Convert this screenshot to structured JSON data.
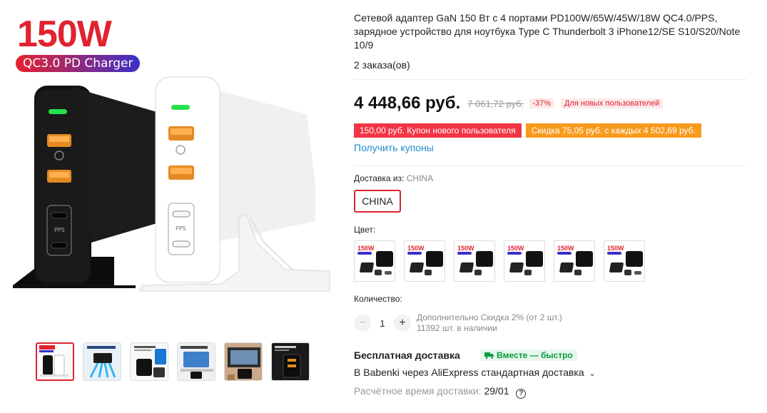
{
  "gallery": {
    "promo_title": "150W",
    "promo_pill": "QC3.0 PD Charger",
    "thumbnails": [
      "thumb-1",
      "thumb-2",
      "thumb-3",
      "thumb-4",
      "thumb-5",
      "thumb-6"
    ]
  },
  "product": {
    "title": "Сетевой адаптер GaN 150 Вт с 4 портами PD100W/65W/45W/18W QC4.0/PPS, зарядное устройство для ноутбука Type C Thunderbolt 3 iPhone12/SE S10/S20/Note 10/9",
    "orders": "2 заказа(ов)"
  },
  "price": {
    "current": "4 448,66 руб.",
    "old": "7 061,72 руб.",
    "discount": "-37%",
    "new_user_badge": "Для новых пользователей"
  },
  "coupons": {
    "coupon_new_user": "150,00 руб. Купон нового пользователя",
    "coupon_discount": "Скидка 75,05 руб. с каждых 4 502,69 руб.",
    "get_coupons": "Получить купоны"
  },
  "shipping_from": {
    "label": "Доставка из:",
    "value": "CHINA",
    "option": "CHINA"
  },
  "color": {
    "label": "Цвет:",
    "swatch_title": "150W"
  },
  "quantity": {
    "label": "Количество:",
    "minus": "−",
    "value": "1",
    "plus": "+",
    "bulk_discount": "Дополнительно Скидка 2% (от 2 шт.)",
    "stock": "11392 шт. в наличии"
  },
  "delivery": {
    "free_shipping": "Бесплатная доставка",
    "together_badge": "Вместе — быстро",
    "carrier": "В Babenki через AliExpress стандартная доставка",
    "eta_label": "Расчётное время доставки:",
    "eta_value": "29/01",
    "help": "?"
  },
  "colors": {
    "accent": "#e0232f",
    "link": "#1d8dc9",
    "coupon_red": "#f23545",
    "coupon_orange": "#f89a1c",
    "green": "#0b9a3d"
  }
}
